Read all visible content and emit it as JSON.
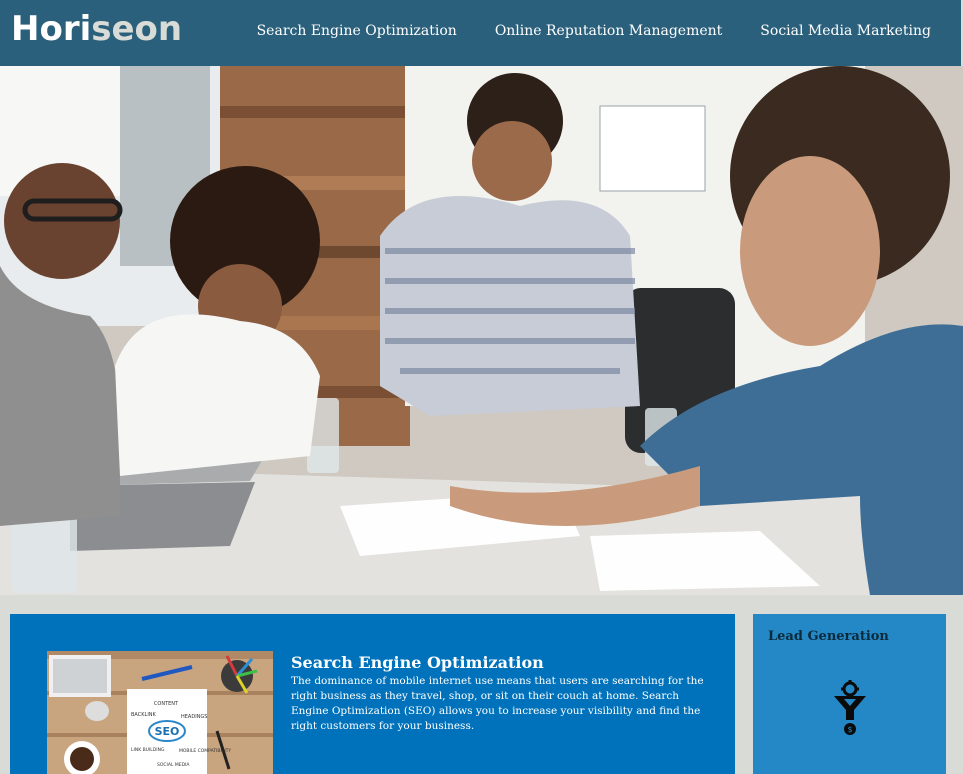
{
  "header": {
    "logo_main": "Hori",
    "logo_accent": "seon"
  },
  "nav": [
    {
      "label": "Search Engine Optimization"
    },
    {
      "label": "Online Reputation Management"
    },
    {
      "label": "Social Media Marketing"
    }
  ],
  "content": {
    "seo": {
      "title": "Search Engine Optimization",
      "text": "The dominance of mobile internet use means that users are searching for the right business as they travel, shop, or sit on their couch at home. Search Engine Optimization (SEO) allows you to increase your visibility and find the right customers for your business.",
      "image_words": [
        "CONTENT",
        "BACKLINK",
        "HEADINGS",
        "SEO",
        "LINK BUILDING",
        "MOBILE COMPATIBILITY",
        "SOCIAL MEDIA"
      ]
    }
  },
  "sidebar": {
    "title": "Lead Generation",
    "icon": "lead-generation-funnel-icon"
  },
  "colors": {
    "header_bg": "#2a607c",
    "page_bg": "#d9dcd6",
    "content_bg": "#0072bb",
    "sidebar_bg": "#2588c6"
  }
}
